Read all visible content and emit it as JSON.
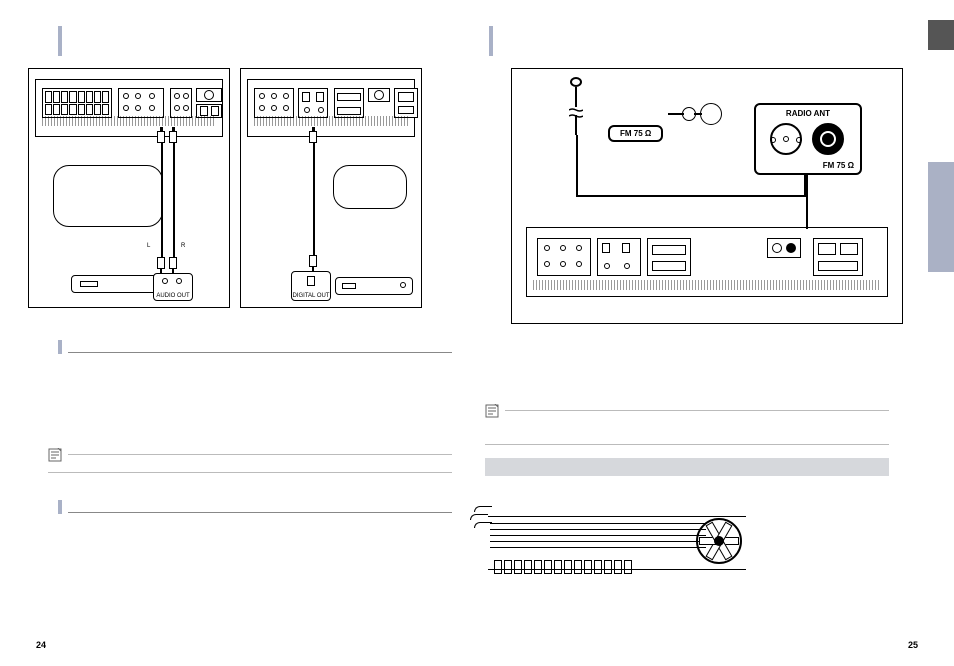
{
  "page_left_num": "24",
  "page_right_num": "25",
  "left_diagram": {
    "audio_out_label": "AUDIO OUT",
    "plug_r": "R",
    "plug_l": "L"
  },
  "right_diagram": {
    "digital_out_label": "DIGITAL OUT"
  },
  "fm_diagram": {
    "fm_badge": "FM 75",
    "fm_unit": "Ω",
    "radio_ant_title": "RADIO ANT",
    "radio_ant_sub": "FM 75 Ω"
  }
}
